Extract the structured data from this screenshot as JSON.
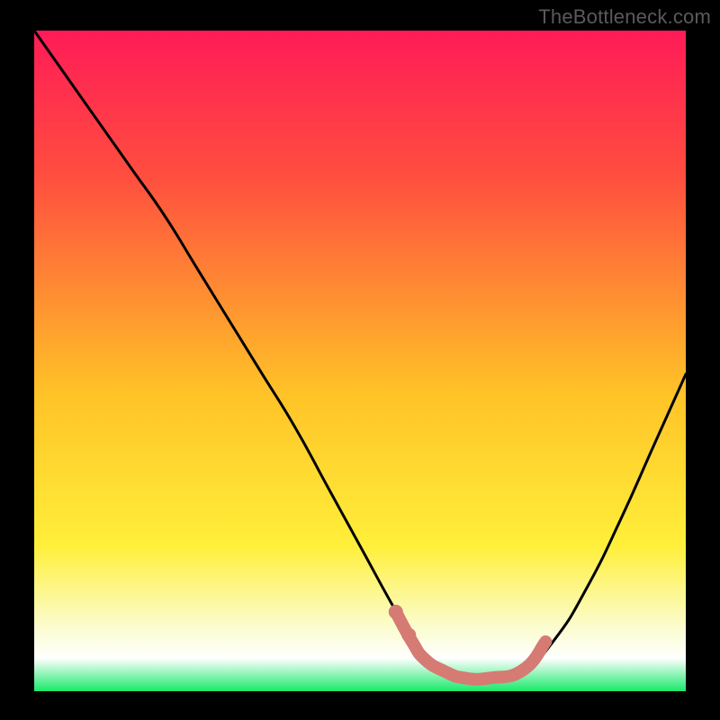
{
  "attribution": "TheBottleneck.com",
  "colors": {
    "frame": "#000000",
    "gradient_top": "#ff1b57",
    "gradient_upper": "#ff4e3f",
    "gradient_mid": "#ffc327",
    "gradient_lower": "#ffef3a",
    "gradient_soft": "#fbfccb",
    "gradient_white": "#ffffff",
    "gradient_bottom": "#19e96a",
    "curve": "#000000",
    "salmon": "#d57b74"
  },
  "chart_data": {
    "type": "line",
    "title": "",
    "xlabel": "",
    "ylabel": "",
    "xlim": [
      0,
      100
    ],
    "ylim": [
      0,
      100
    ],
    "series": [
      {
        "name": "bottleneck-curve",
        "x": [
          0,
          5,
          10,
          15,
          20,
          25,
          30,
          35,
          40,
          45,
          50,
          55,
          58,
          60,
          63,
          66,
          70,
          75,
          80,
          85,
          90,
          95,
          100
        ],
        "y": [
          100,
          93,
          86,
          79,
          72,
          64,
          56,
          48,
          40,
          31,
          22,
          13,
          8,
          5,
          3,
          2,
          2,
          3,
          8,
          16,
          26,
          37,
          48
        ]
      }
    ],
    "salmon_segment": {
      "name": "highlighted-range",
      "x": [
        55.5,
        58,
        60,
        63,
        66,
        70,
        75,
        78.5
      ],
      "y": [
        12,
        7.5,
        4.8,
        3,
        2,
        2,
        3.2,
        7.5
      ]
    },
    "salmon_dots": [
      {
        "x": 55.5,
        "y": 12
      },
      {
        "x": 57.5,
        "y": 8.5
      }
    ]
  }
}
